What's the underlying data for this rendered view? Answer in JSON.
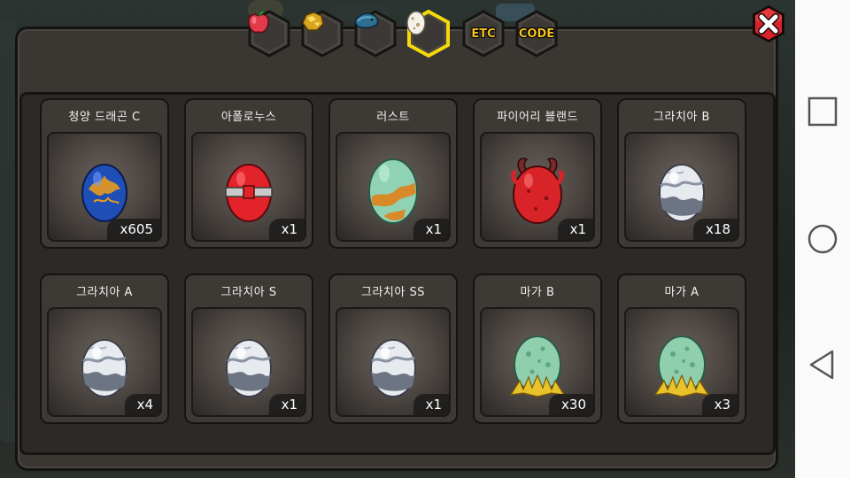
{
  "tabs": [
    {
      "id": "fruit",
      "label": "",
      "icon": "apple-icon",
      "active": false
    },
    {
      "id": "gold",
      "label": "",
      "icon": "gold-nugget-icon",
      "active": false
    },
    {
      "id": "fish",
      "label": "",
      "icon": "fish-icon",
      "active": false
    },
    {
      "id": "egg",
      "label": "",
      "icon": "egg-icon",
      "active": true
    },
    {
      "id": "etc",
      "label": "ETC",
      "icon": "",
      "active": false
    },
    {
      "id": "code",
      "label": "CODE",
      "icon": "",
      "active": false
    }
  ],
  "items": [
    {
      "name": "청양 드래곤 C",
      "qty": "x605",
      "egg": "blue-flame"
    },
    {
      "name": "아폴로누스",
      "qty": "x1",
      "egg": "red-band"
    },
    {
      "name": "러스트",
      "qty": "x1",
      "egg": "mint-orange"
    },
    {
      "name": "파이어리 블랜드",
      "qty": "x1",
      "egg": "red-horned"
    },
    {
      "name": "그라치아 B",
      "qty": "x18",
      "egg": "silver-cloud"
    },
    {
      "name": "그라치아 A",
      "qty": "x4",
      "egg": "silver-cloud"
    },
    {
      "name": "그라치아 S",
      "qty": "x1",
      "egg": "silver-cloud"
    },
    {
      "name": "그라치아 SS",
      "qty": "x1",
      "egg": "silver-cloud"
    },
    {
      "name": "마가 B",
      "qty": "x30",
      "egg": "mint-nest"
    },
    {
      "name": "마가 A",
      "qty": "x3",
      "egg": "mint-nest"
    }
  ],
  "colors": {
    "tab_active_border": "#f5d90a",
    "label": "#f4c21a",
    "close_red": "#d9232b"
  }
}
